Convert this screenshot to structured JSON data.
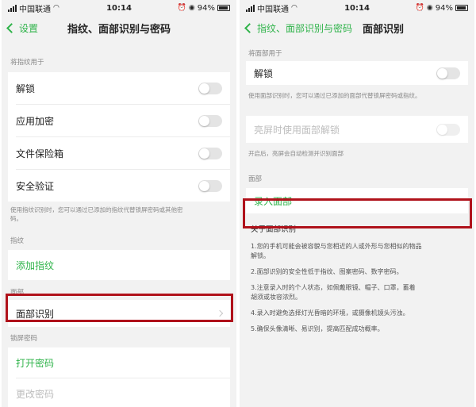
{
  "status_bar": {
    "carrier": "中国联通",
    "time": "10:14",
    "battery_percent": "94%"
  },
  "left_screen": {
    "back_label": "设置",
    "title": "指纹、面部识别与密码",
    "fingerprint_usage_header": "将指纹用于",
    "fingerprint_usage_items": [
      {
        "label": "解锁",
        "on": false
      },
      {
        "label": "应用加密",
        "on": false
      },
      {
        "label": "文件保险箱",
        "on": false
      },
      {
        "label": "安全验证",
        "on": false
      }
    ],
    "fingerprint_note_line1": "使用指纹识别时，您可以通过已添加的指纹代替锁屏密码或其他密",
    "fingerprint_note_line2": "码。",
    "fingerprint_header": "指纹",
    "add_fingerprint_label": "添加指纹",
    "face_header": "面部",
    "face_recognition_label": "面部识别",
    "lock_password_header": "锁屏密码",
    "open_password_label": "打开密码",
    "change_password_label": "更改密码"
  },
  "right_screen": {
    "back_label": "指纹、面部识别与密码",
    "title": "面部识别",
    "face_usage_header": "将面部用于",
    "unlock_label": "解锁",
    "unlock_on": false,
    "unlock_note": "使用面部识别时，您可以通过已添加的面部代替锁屏密码或指纹。",
    "screen_on_unlock_label": "亮屏时使用面部解锁",
    "screen_on_note": "开启后，亮屏会自动检测并识别面部",
    "face_header": "面部",
    "enroll_face_label": "录入面部",
    "about_title": "关于面部识别",
    "about_items": [
      [
        "1.您的手机可能会被容貌与您相近的人或外形与您相似的物品",
        "解锁。"
      ],
      [
        "2.面部识别的安全性低于指纹、图案密码、数字密码。"
      ],
      [
        "3.注意录入时的个人状态，如佩戴眼镜、帽子、口罩，蓄着",
        "胡须或妆容浓烈。"
      ],
      [
        "4.录入时避免选择灯光昏暗的环境，或摄像机镜头污浊。"
      ],
      [
        "5.确保头像清晰、易识别，提高匹配成功概率。"
      ]
    ]
  },
  "colors": {
    "accent_green": "#2fb34a",
    "highlight_red": "#b0121b",
    "background": "#f2f2f2"
  },
  "icons": [
    "signal-icon",
    "wifi-icon",
    "alarm-icon",
    "eye-icon",
    "battery-icon",
    "back-chevron-icon",
    "chevron-right-icon"
  ]
}
